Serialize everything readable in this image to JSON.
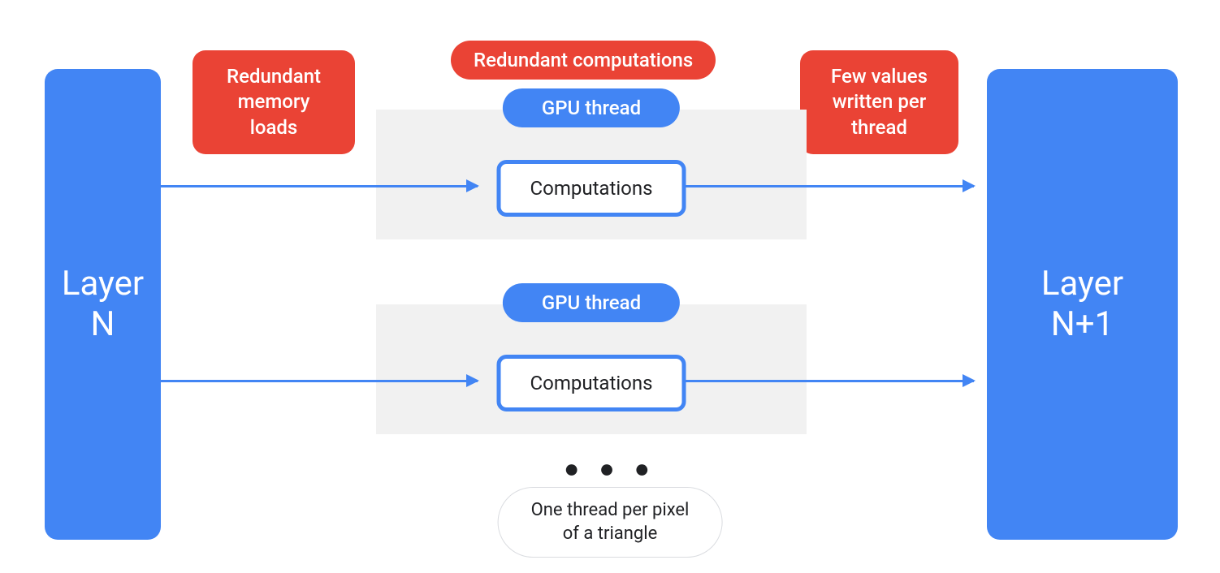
{
  "layers": {
    "left": "Layer\nN",
    "right": "Layer\nN+1"
  },
  "callouts": {
    "redundant_memory": "Redundant\nmemory\nloads",
    "redundant_computations": "Redundant computations",
    "few_values": "Few values\nwritten per\nthread"
  },
  "threads": {
    "gpu_thread_label": "GPU thread",
    "computations_label": "Computations"
  },
  "ellipsis": "● ● ●",
  "caption": "One thread per pixel\nof a triangle",
  "colors": {
    "blue": "#4285F4",
    "red": "#EA4335",
    "gray_bg": "#F1F1F1"
  }
}
